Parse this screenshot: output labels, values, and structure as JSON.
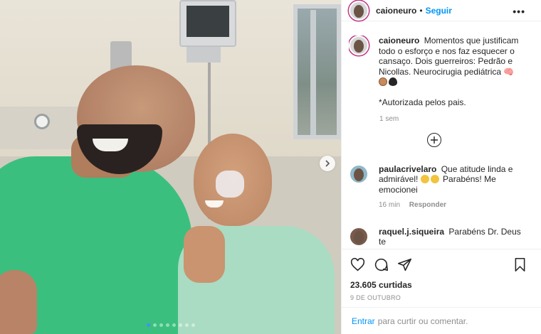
{
  "post": {
    "carousel": {
      "dot_count": 8,
      "active_index": 0
    }
  },
  "header": {
    "username": "caioneuro",
    "separator": "•",
    "follow_label": "Seguir",
    "more_label": "•••"
  },
  "caption": {
    "username": "caioneuro",
    "text": "Momentos que justificam todo o esforço e nos faz esquecer o cansaço. Dois guerreiros: Pedrão e Nicollas. Neurocirugia pediátrica",
    "note": "*Autorizada pelos pais.",
    "time": "1 sem"
  },
  "comments": [
    {
      "username": "paulacrivelaro",
      "text": "Que atitude linda e admirável!",
      "text2": "Parabéns! Me emocionei",
      "time": "16 min",
      "reply_label": "Responder"
    },
    {
      "username": "raquel.j.siqueira",
      "text": "Parabéns Dr. Deus te"
    }
  ],
  "actions": {
    "likes": "23.605 curtidas",
    "date": "9 de outubro"
  },
  "login": {
    "link": "Entrar",
    "text": "para curtir ou comentar."
  },
  "icons": {
    "like": "heart-icon",
    "comment": "comment-icon",
    "share": "share-icon",
    "save": "bookmark-icon",
    "load_more": "plus-circle-icon",
    "next": "chevron-right-icon"
  },
  "colors": {
    "link": "#0095f6",
    "muted": "#8e8e8e",
    "text": "#262626"
  }
}
